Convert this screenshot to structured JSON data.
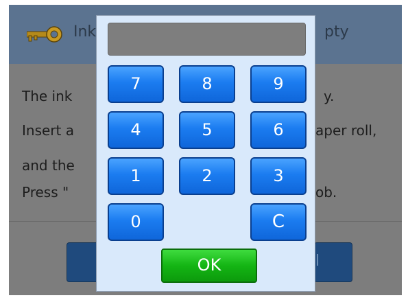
{
  "background_dialog": {
    "title_left": "Ink",
    "title_right": "pty",
    "lines": [
      {
        "left": "The ink",
        "right": "y."
      },
      {
        "left": "Insert a",
        "right": "aper roll,"
      },
      {
        "left": "and the",
        "right": ""
      },
      {
        "left": "Press \"",
        "right": "ob."
      }
    ],
    "right_button_fragment": "l"
  },
  "keypad": {
    "display_value": "",
    "keys": [
      "7",
      "8",
      "9",
      "4",
      "5",
      "6",
      "1",
      "2",
      "3",
      "0",
      "C"
    ],
    "ok_label": "OK"
  },
  "colors": {
    "key_blue": "#1b7cf0",
    "ok_green": "#14b514",
    "header_blue": "#5b7390"
  },
  "icons": {
    "title_icon": "key-icon"
  }
}
